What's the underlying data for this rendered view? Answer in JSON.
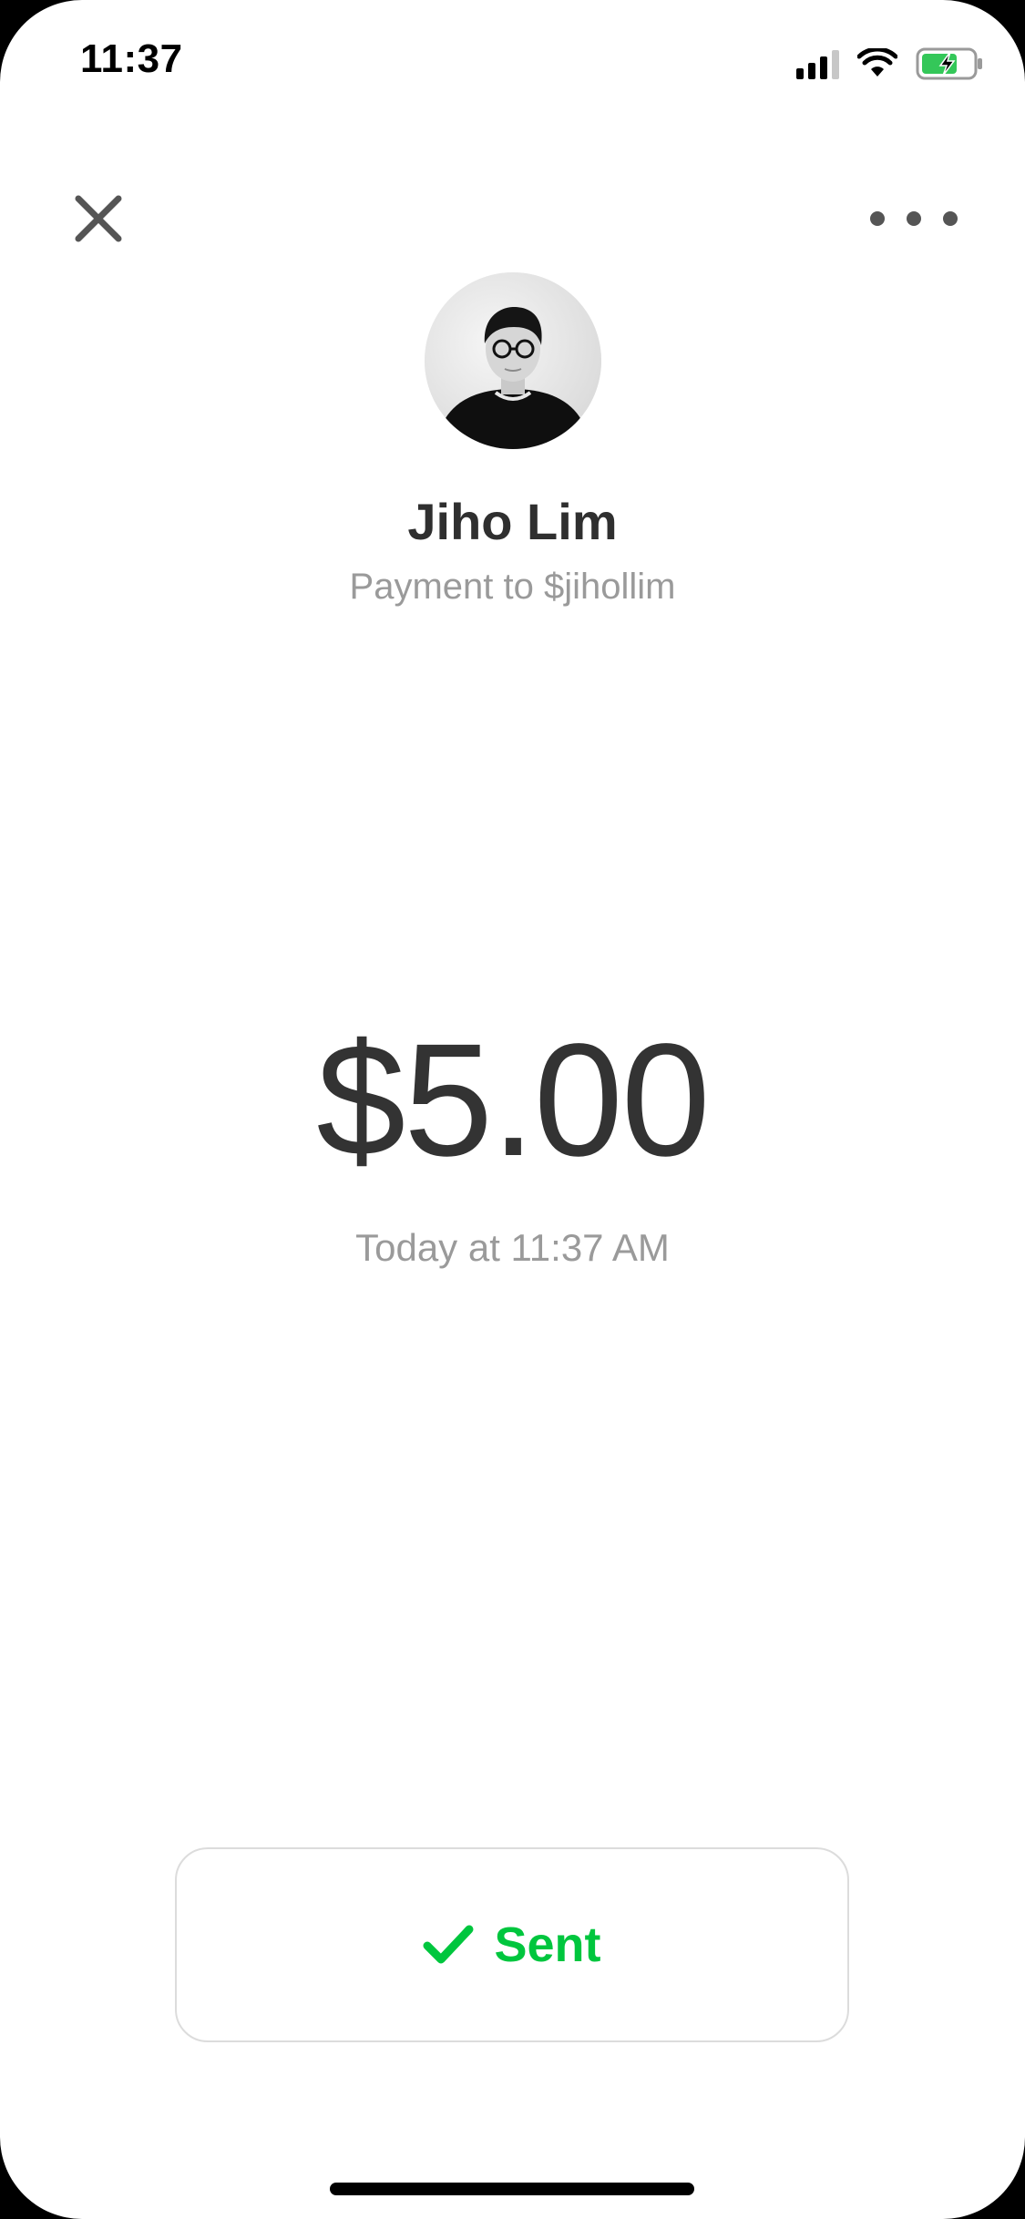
{
  "status_bar": {
    "time": "11:37",
    "icons": [
      "cellular-signal-icon",
      "wifi-icon",
      "battery-charging-icon"
    ]
  },
  "nav": {
    "close_icon": "close-icon",
    "more_icon": "more-horizontal-icon"
  },
  "recipient": {
    "name": "Jiho Lim",
    "subtitle": "Payment to $jihollim"
  },
  "payment": {
    "amount": "$5.00",
    "timestamp": "Today at 11:37 AM"
  },
  "status": {
    "label": "Sent",
    "icon": "checkmark-icon",
    "color": "#00c63e"
  },
  "colors": {
    "background": "#ffffff",
    "text_primary": "#333333",
    "text_secondary": "#9a9a9a",
    "accent_green": "#00c63e"
  }
}
